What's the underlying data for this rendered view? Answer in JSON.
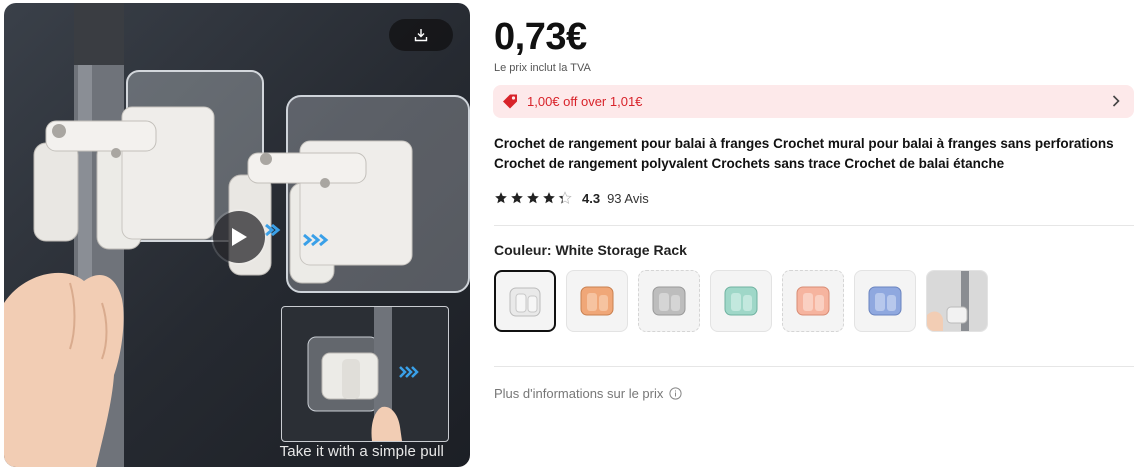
{
  "media": {
    "caption": "Take it with a simple pull",
    "download_icon": "download-icon",
    "play_icon": "play-icon"
  },
  "product": {
    "price": "0,73€",
    "vat_note": "Le prix inclut la TVA",
    "promo": {
      "text": "1,00€ off over 1,01€",
      "icon": "tag-icon",
      "color": "#d8232a",
      "background": "#fde9ea"
    },
    "title": "Crochet de rangement pour balai à franges Crochet mural pour balai à franges sans perforations Crochet de rangement polyvalent Crochets sans trace Crochet de balai étanche",
    "rating": {
      "stars": 4.3,
      "score": "4.3",
      "reviews": "93 Avis"
    },
    "color": {
      "label": "Couleur:",
      "value": "White Storage Rack"
    },
    "swatches": [
      {
        "name": "white",
        "tint": "#e9e9e9",
        "selected": true
      },
      {
        "name": "orange",
        "tint": "#f0a778",
        "selected": false
      },
      {
        "name": "grey",
        "tint": "#bdbdbd",
        "selected": false
      },
      {
        "name": "mint",
        "tint": "#9fd7c8",
        "selected": false
      },
      {
        "name": "peach",
        "tint": "#f6b49f",
        "selected": false
      },
      {
        "name": "blue",
        "tint": "#8fa8df",
        "selected": false
      },
      {
        "name": "photo",
        "tint": "#d9d9d9",
        "selected": false
      }
    ],
    "more_info": "Plus d'informations sur le prix"
  }
}
